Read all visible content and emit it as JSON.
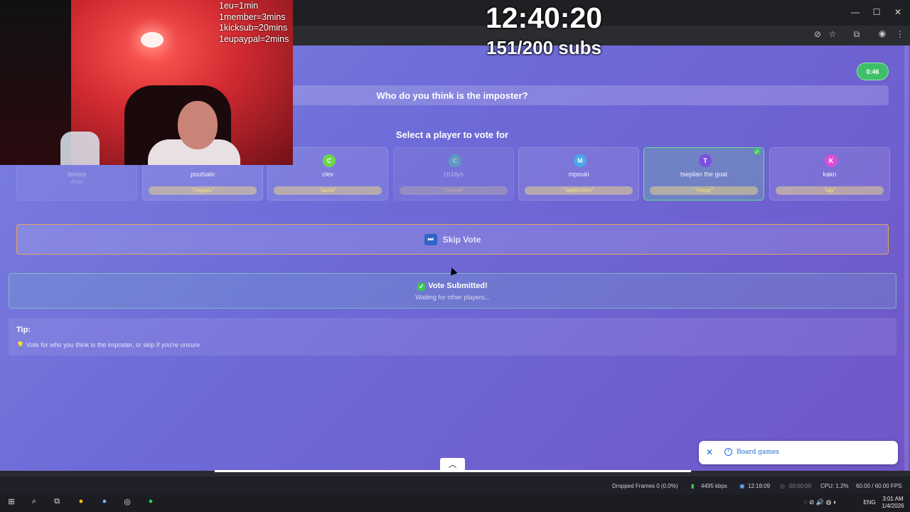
{
  "overlay": {
    "rules": [
      "1eu=1min",
      "1member=3mins",
      "1kicksub=20mins",
      "1eupaypal=2mins"
    ],
    "clock": "12:40:20",
    "subs": "151/200 subs"
  },
  "game": {
    "timer": "0:46",
    "question": "Who do you think is the imposter?",
    "select_title": "Select a player to vote for",
    "players": [
      {
        "initial": "",
        "name": "tsiotos",
        "word": "dead",
        "color": "#6b86d6",
        "state": "dim"
      },
      {
        "initial": "",
        "name": "poutsalo",
        "word": "\"megalo\"",
        "color": "#e0b53a",
        "state": "normal"
      },
      {
        "initial": "C",
        "name": "clev",
        "word": "\"ouria\"",
        "color": "#6bd84a",
        "state": "normal"
      },
      {
        "initial": "C",
        "name": "ch1llys",
        "word": "\"kateva\"",
        "color": "#4fc3a8",
        "state": "dim"
      },
      {
        "initial": "M",
        "name": "mpouki",
        "word": "\"epikindino\"",
        "color": "#4aa8e8",
        "state": "normal"
      },
      {
        "initial": "T",
        "name": "tsepilan the goat",
        "word": "\"meoq\"",
        "color": "#7a4fe0",
        "state": "selected"
      },
      {
        "initial": "K",
        "name": "kakn",
        "word": "\"olg\"",
        "color": "#d94fd6",
        "state": "normal"
      }
    ],
    "skip_label": "Skip Vote",
    "submitted_title": "Vote Submitted!",
    "submitted_text": "Waiting for other players...",
    "tip_title": "Tip:",
    "tip_text": "Vote for who you think is the imposter, or skip if you're unsure"
  },
  "toast": {
    "label": "Board games"
  },
  "status": {
    "dropped": "Dropped Frames 0 (0.0%)",
    "bitrate": "4495 kbps",
    "rec_time": "12:18:09",
    "stream_time": "00:00:00",
    "cpu": "CPU: 1.2%",
    "fps": "60.00 / 60.00 FPS"
  },
  "taskbar": {
    "lang": "ENG",
    "time": "3:01 AM",
    "date": "1/4/2026"
  },
  "colors": {
    "accent_green": "#3fbf6a",
    "skip_border": "#e7a65a"
  }
}
